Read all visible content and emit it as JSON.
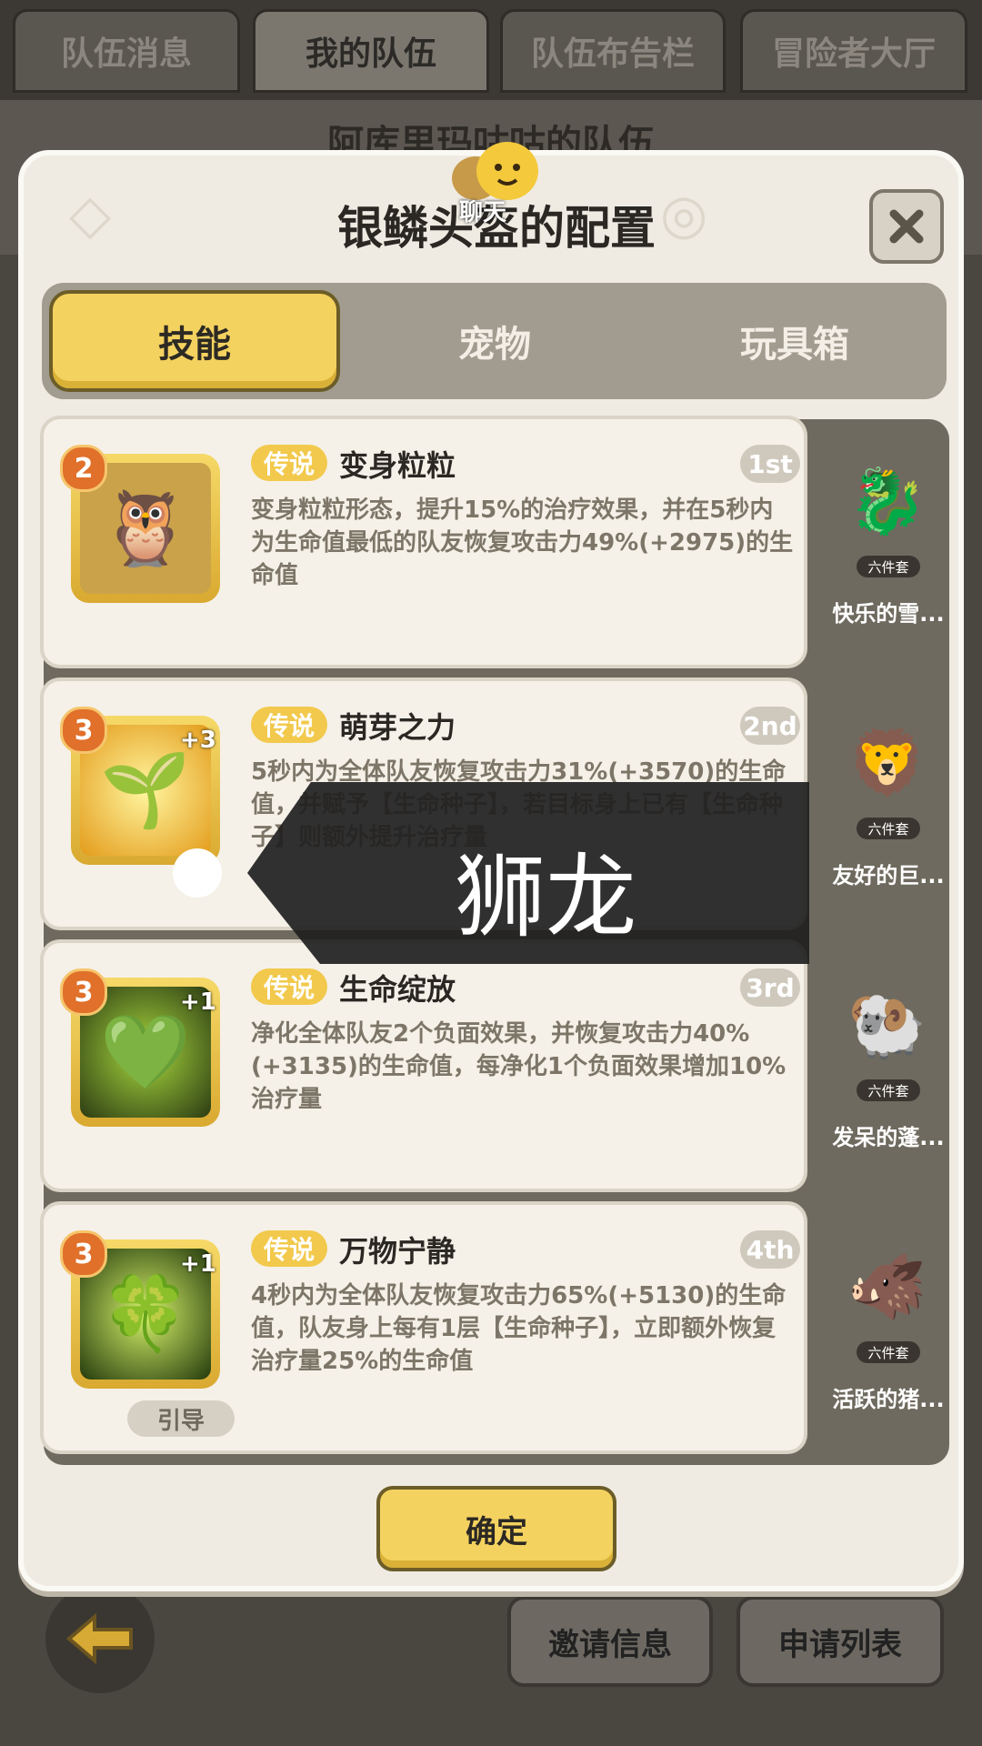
{
  "top_tabs": [
    "队伍消息",
    "我的队伍",
    "队伍布告栏",
    "冒险者大厅"
  ],
  "team_title": "阿库里玛咕咕的队伍",
  "modal": {
    "title": "银鳞头盔的配置",
    "chat_label": "聊天",
    "tabs": [
      "技能",
      "宠物",
      "玩具箱"
    ],
    "confirm_label": "确定"
  },
  "skills": [
    {
      "level": "2",
      "plus": "",
      "rarity": "传说",
      "name": "变身粒粒",
      "rank": "1st",
      "desc": "变身粒粒形态，提升15%的治疗效果，并在5秒内为生命值最低的队友恢复攻击力49%(+2975)的生命值",
      "guide": ""
    },
    {
      "level": "3",
      "plus": "+3",
      "rarity": "传说",
      "name": "萌芽之力",
      "rank": "2nd",
      "desc": "5秒内为全体队友恢复攻击力31%(+3570)的生命值，并赋予【生命种子】，若目标身上已有【生命种子】则额外提升治疗量",
      "guide": ""
    },
    {
      "level": "3",
      "plus": "+1",
      "rarity": "传说",
      "name": "生命绽放",
      "rank": "3rd",
      "desc": "净化全体队友2个负面效果，并恢复攻击力40%(+3135)的生命值，每净化1个负面效果增加10%治疗量",
      "guide": ""
    },
    {
      "level": "3",
      "plus": "+1",
      "rarity": "传说",
      "name": "万物宁静",
      "rank": "4th",
      "desc": "4秒内为全体队友恢复攻击力65%(+5130)的生命值，队友身上每有1层【生命种子】，立即额外恢复治疗量25%的生命值",
      "guide": "引导"
    }
  ],
  "pets": [
    {
      "tag": "六件套",
      "name": "快乐的雪..."
    },
    {
      "tag": "六件套",
      "name": "友好的巨..."
    },
    {
      "tag": "六件套",
      "name": "发呆的蓬..."
    },
    {
      "tag": "六件套",
      "name": "活跃的猪..."
    }
  ],
  "bottom": {
    "invite_label": "邀请信息",
    "apply_label": "申请列表"
  },
  "overlay": {
    "text": "狮龙"
  }
}
